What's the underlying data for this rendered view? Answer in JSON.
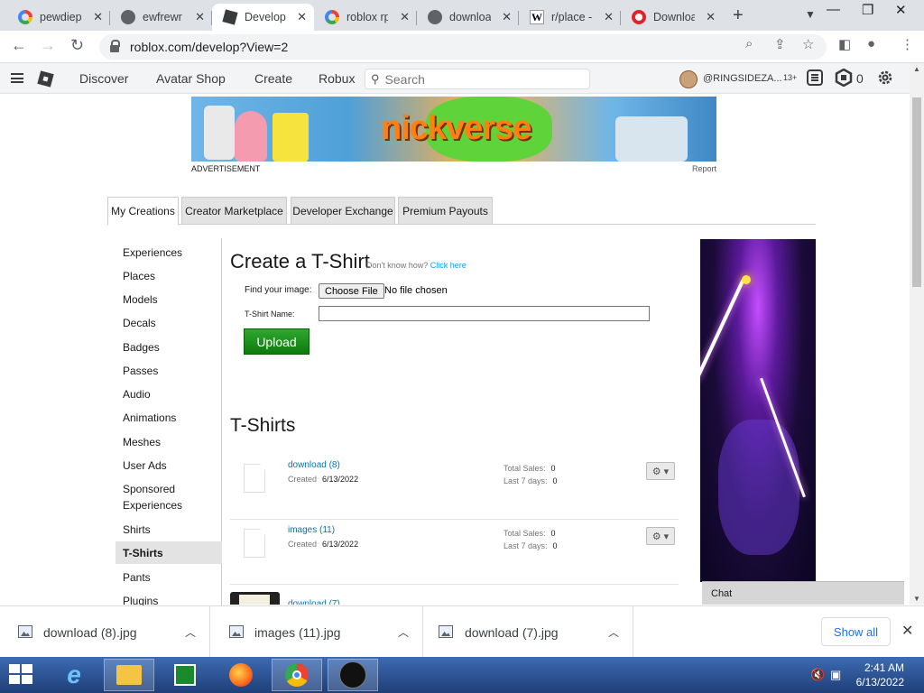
{
  "browser": {
    "tabs": [
      {
        "title": "pewdiep",
        "icon": "google-icon",
        "active": false
      },
      {
        "title": "ewfrewr",
        "icon": "globe-icon",
        "active": false
      },
      {
        "title": "Develop",
        "icon": "roblox-icon",
        "active": true
      },
      {
        "title": "roblox rp",
        "icon": "google-icon",
        "active": false
      },
      {
        "title": "downloa",
        "icon": "globe-icon",
        "active": false
      },
      {
        "title": "r/place -",
        "icon": "wikipedia-icon",
        "active": false
      },
      {
        "title": "Downloa",
        "icon": "download-site-icon",
        "active": false
      }
    ],
    "url": "roblox.com/develop?View=2"
  },
  "roblox_header": {
    "nav": [
      "Discover",
      "Avatar Shop",
      "Create",
      "Robux"
    ],
    "search_placeholder": "Search",
    "username": "@RINGSIDEZA...",
    "age_badge": "13+",
    "robux_count": "0"
  },
  "ad": {
    "banner_text": "nickverse",
    "label": "ADVERTISEMENT",
    "report": "Report"
  },
  "develop_tabs": [
    "My Creations",
    "Creator Marketplace",
    "Developer Exchange",
    "Premium Payouts"
  ],
  "left_menu": [
    "Experiences",
    "Places",
    "Models",
    "Decals",
    "Badges",
    "Passes",
    "Audio",
    "Animations",
    "Meshes",
    "User Ads",
    "Sponsored Experiences",
    "Shirts",
    "T-Shirts",
    "Pants",
    "Plugins"
  ],
  "selected_menu": "T-Shirts",
  "create": {
    "title": "Create a T-Shirt",
    "help_prefix": "Don't know how?",
    "help_link": "Click here",
    "image_label": "Find your image:",
    "choose_file": "Choose File",
    "no_file": "No file chosen",
    "name_label": "T-Shirt Name:",
    "upload": "Upload"
  },
  "tshirts": {
    "heading": "T-Shirts",
    "created_label": "Created",
    "total_sales_label": "Total Sales:",
    "last7_label": "Last 7 days:",
    "items": [
      {
        "name": "download (8)",
        "created": "6/13/2022",
        "total_sales": "0",
        "last_7_days": "0"
      },
      {
        "name": "images (11)",
        "created": "6/13/2022",
        "total_sales": "0",
        "last_7_days": "0"
      }
    ],
    "partial_item": "download (7)"
  },
  "chat": "Chat",
  "downloads": {
    "files": [
      "download (8).jpg",
      "images (11).jpg",
      "download (7).jpg"
    ],
    "show_all": "Show all"
  },
  "taskbar": {
    "time": "2:41 AM",
    "date": "6/13/2022"
  },
  "colors": {
    "accent_green": "#0c7a0c",
    "link_blue": "#0074bd",
    "chrome_blue": "#1a73e8"
  }
}
